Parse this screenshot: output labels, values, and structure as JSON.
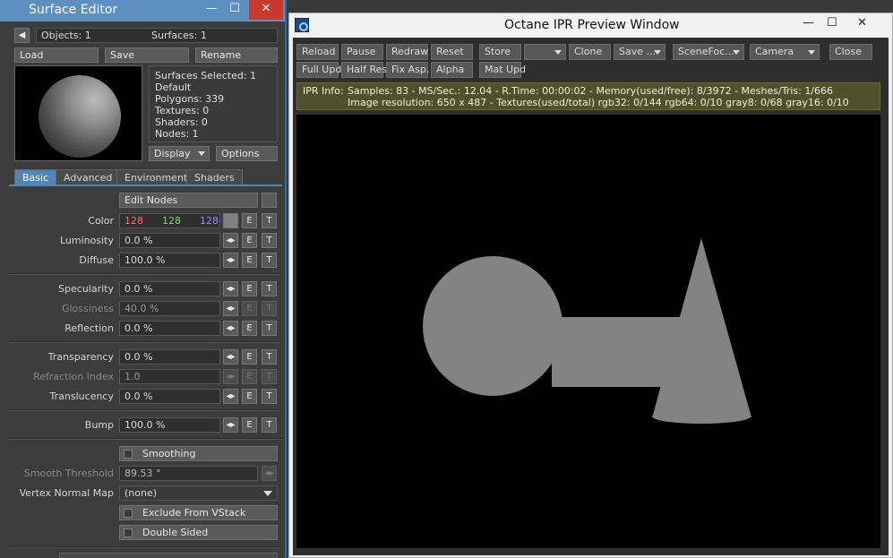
{
  "surface_editor": {
    "title": "Surface Editor",
    "window_buttons": {
      "minimize": "—",
      "maximize": "☐",
      "close": "✕"
    },
    "objects_label": "Objects: 1",
    "surfaces_label": "Surfaces: 1",
    "load": "Load",
    "save": "Save",
    "rename": "Rename",
    "info": [
      "Surfaces Selected: 1",
      "Default",
      "Polygons: 339",
      "Textures: 0",
      "Shaders: 0",
      "Nodes: 1"
    ],
    "display": "Display",
    "options": "Options",
    "tabs": [
      "Basic",
      "Advanced",
      "Environment",
      "Shaders"
    ],
    "edit_nodes": "Edit Nodes",
    "color": {
      "label": "Color",
      "r": "128",
      "g": "128",
      "b": "128",
      "r_color": "#ff6b6b",
      "g_color": "#7bd67b",
      "b_color": "#8f8fff"
    },
    "luminosity": {
      "label": "Luminosity",
      "value": "0.0 %"
    },
    "diffuse": {
      "label": "Diffuse",
      "value": "100.0 %"
    },
    "specularity": {
      "label": "Specularity",
      "value": "0.0 %"
    },
    "glossiness": {
      "label": "Glossiness",
      "value": "40.0 %"
    },
    "reflection": {
      "label": "Reflection",
      "value": "0.0 %"
    },
    "transparency": {
      "label": "Transparency",
      "value": "0.0 %"
    },
    "refraction_index": {
      "label": "Refraction Index",
      "value": "1.0"
    },
    "translucency": {
      "label": "Translucency",
      "value": "0.0 %"
    },
    "bump": {
      "label": "Bump",
      "value": "100.0 %"
    },
    "smoothing": "Smoothing",
    "smooth_threshold": {
      "label": "Smooth Threshold",
      "value": "89.53 °"
    },
    "vertex_normal_map": {
      "label": "Vertex Normal Map",
      "value": "(none)"
    },
    "exclude_from_vstack": "Exclude From VStack",
    "double_sided": "Double Sided",
    "e_btn": "E",
    "t_btn": "T",
    "arrows": "◂▸"
  },
  "octane": {
    "title": "Octane IPR Preview Window",
    "window_buttons": {
      "minimize": "—",
      "maximize": "☐",
      "close": "✕"
    },
    "toolbar_row1": [
      "Reload",
      "Pause",
      "Redraw",
      "Reset",
      "Store",
      "",
      "Clone",
      "Save ...",
      "SceneFoc...",
      "Camera",
      "Close"
    ],
    "toolbar_row2": [
      "Full Upd.",
      "Half Res",
      "Fix Asp.",
      "Alpha",
      "Mat Upd"
    ],
    "info_label": "IPR Info:",
    "info_line1": "Samples: 83  -  MS/Sec.: 12.04  -  R.Time: 00:00:02 - Memory(used/free): 8/3972  -  Meshes/Tris: 1/666",
    "info_line2": "Image resolution: 650 x 487 - Textures(used/total) rgb32: 0/144   rgb64: 0/10   gray8: 0/68   gray16: 0/10",
    "render_shape_color": "#838383"
  }
}
